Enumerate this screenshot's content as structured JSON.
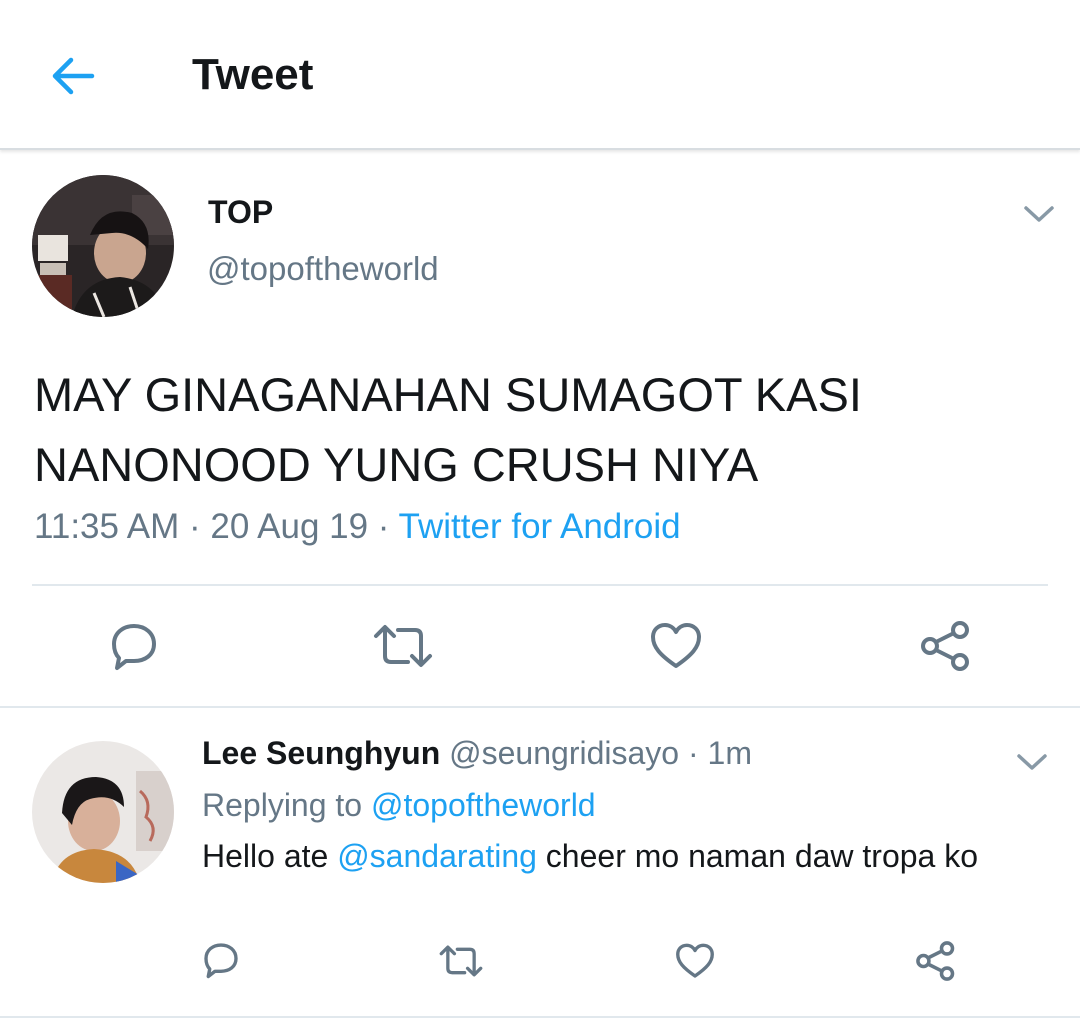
{
  "header": {
    "title": "Tweet",
    "back_icon": "arrow-left-icon",
    "accent": "#1da1f2"
  },
  "tweet": {
    "author_name": "TOP",
    "author_handle": "@topoftheworld",
    "text_line1": "MAY GINAGANAHAN SUMAGOT KASI",
    "text_line2": "NANONOOD YUNG CRUSH NIYA",
    "time": "11:35 AM",
    "date": "20 Aug 19",
    "separator": "·",
    "source": "Twitter for Android",
    "actions": [
      "reply-icon",
      "retweet-icon",
      "like-icon",
      "share-icon"
    ]
  },
  "reply": {
    "author_name": "Lee Seunghyun",
    "author_handle": "@seungridisayo",
    "separator": "·",
    "time": "1m",
    "replying_prefix": "Replying to",
    "replying_to": "@topoftheworld",
    "text_before": "Hello ate",
    "mention": "@sandarating",
    "text_after": "cheer mo naman daw tropa ko",
    "actions": [
      "reply-icon",
      "retweet-icon",
      "like-icon",
      "share-icon"
    ]
  },
  "colors": {
    "text": "#14171a",
    "secondary": "#657786",
    "link": "#1da1f2",
    "divider": "#e1e8ed"
  }
}
